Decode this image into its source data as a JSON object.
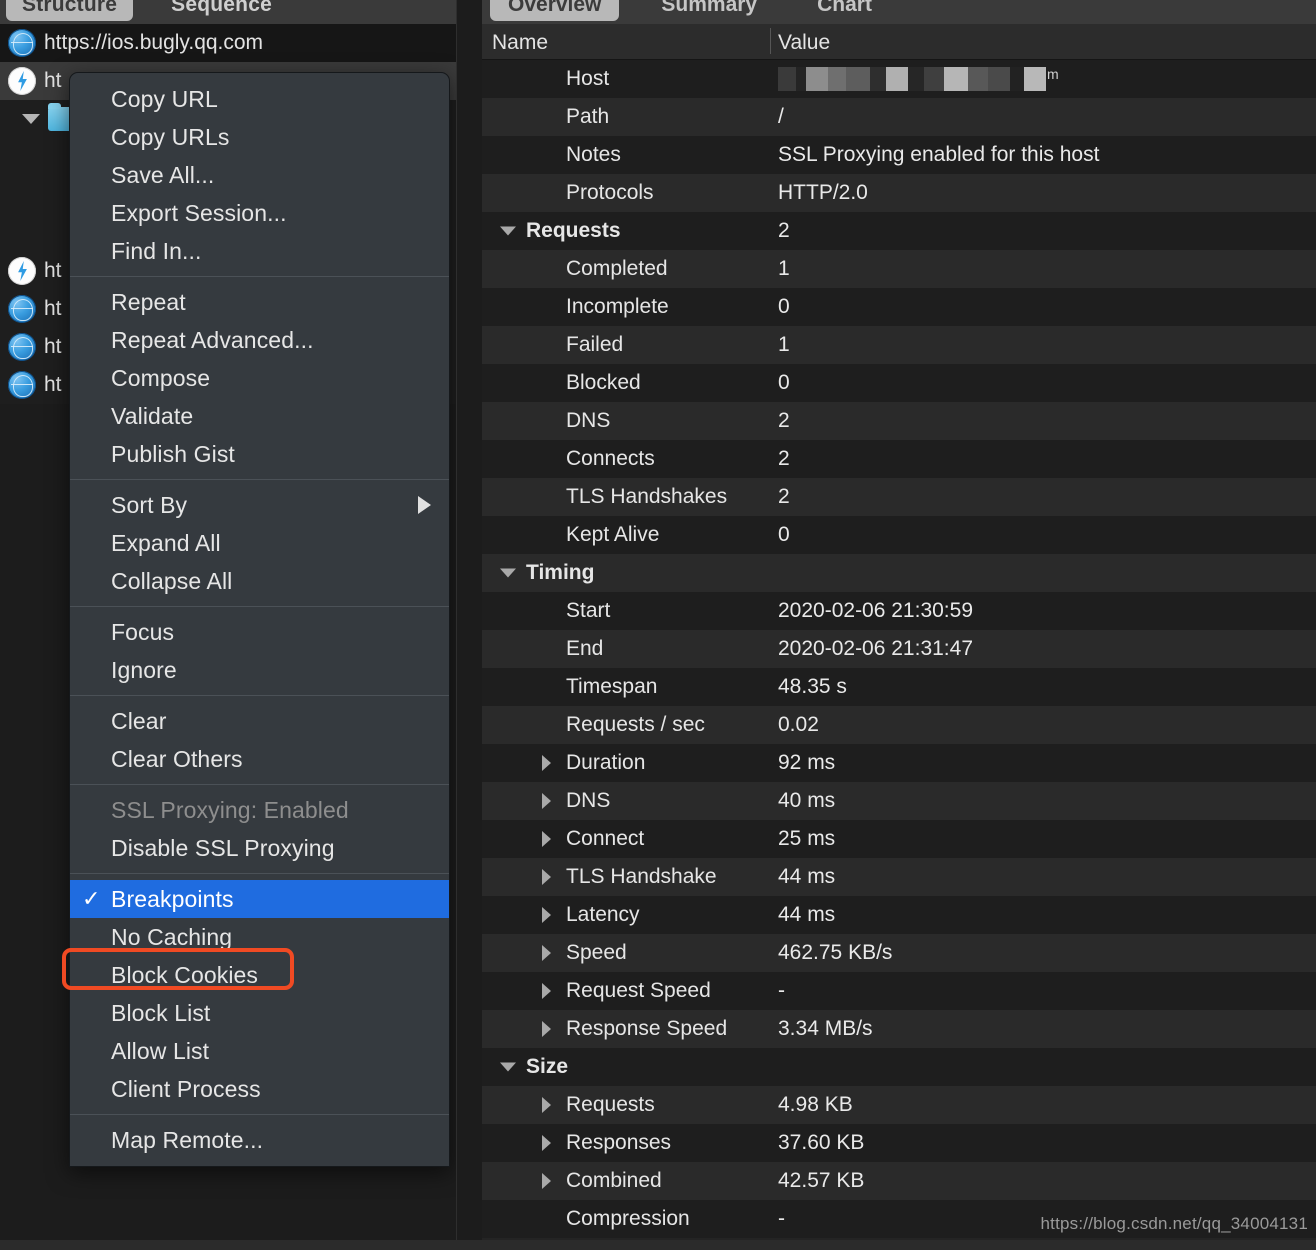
{
  "left_panel": {
    "tabs": [
      {
        "label": "Structure",
        "selected": true
      },
      {
        "label": "Sequence",
        "selected": false
      }
    ],
    "rows": [
      {
        "icon": "globe-icon",
        "label": "https://ios.bugly.qq.com",
        "style": "plain"
      },
      {
        "icon": "bolt-icon",
        "label": "ht",
        "style": "selected"
      },
      {
        "icon": "folder-icon",
        "label": "",
        "style": "disclosure"
      },
      {
        "icon": "none",
        "label": "",
        "style": "blank"
      },
      {
        "icon": "none",
        "label": "",
        "style": "blank"
      },
      {
        "icon": "none",
        "label": "",
        "style": "blank"
      },
      {
        "icon": "bolt-icon",
        "label": "ht",
        "style": "plain"
      },
      {
        "icon": "globe-icon",
        "label": "ht",
        "style": "plain"
      },
      {
        "icon": "globe-icon",
        "label": "ht",
        "style": "plain"
      },
      {
        "icon": "globe-icon",
        "label": "ht",
        "style": "plain"
      }
    ]
  },
  "context_menu": {
    "groups": [
      {
        "items": [
          {
            "label": "Copy URL"
          },
          {
            "label": "Copy URLs"
          },
          {
            "label": "Save All..."
          },
          {
            "label": "Export Session..."
          },
          {
            "label": "Find In..."
          }
        ]
      },
      {
        "items": [
          {
            "label": "Repeat"
          },
          {
            "label": "Repeat Advanced..."
          },
          {
            "label": "Compose"
          },
          {
            "label": "Validate"
          },
          {
            "label": "Publish Gist"
          }
        ]
      },
      {
        "items": [
          {
            "label": "Sort By",
            "submenu": true
          },
          {
            "label": "Expand All"
          },
          {
            "label": "Collapse All"
          }
        ]
      },
      {
        "items": [
          {
            "label": "Focus"
          },
          {
            "label": "Ignore"
          }
        ]
      },
      {
        "items": [
          {
            "label": "Clear"
          },
          {
            "label": "Clear Others"
          }
        ]
      },
      {
        "items": [
          {
            "label": "SSL Proxying: Enabled",
            "disabled": true
          },
          {
            "label": "Disable SSL Proxying"
          }
        ]
      },
      {
        "items": [
          {
            "label": "Breakpoints",
            "checked": true,
            "highlighted": true
          },
          {
            "label": "No Caching"
          },
          {
            "label": "Block Cookies"
          },
          {
            "label": "Block List"
          },
          {
            "label": "Allow List"
          },
          {
            "label": "Client Process"
          }
        ]
      },
      {
        "items": [
          {
            "label": "Map Remote..."
          }
        ]
      }
    ],
    "checkmark_glyph": "✓",
    "highlight_color": "#1f6ce0",
    "annotation_color": "#f04a23"
  },
  "right_panel": {
    "tabs": [
      {
        "label": "Overview",
        "selected": true
      },
      {
        "label": "Summary",
        "selected": false
      },
      {
        "label": "Chart",
        "selected": false
      }
    ],
    "columns": {
      "name": "Name",
      "value": "Value"
    },
    "rows": [
      {
        "name": "Host",
        "value": "",
        "level": 1,
        "redacted": true,
        "redacted_suffix": "m"
      },
      {
        "name": "Path",
        "value": "/",
        "level": 1
      },
      {
        "name": "Notes",
        "value": "SSL Proxying enabled for this host",
        "level": 1
      },
      {
        "name": "Protocols",
        "value": "HTTP/2.0",
        "level": 1
      },
      {
        "name": "Requests",
        "value": "2",
        "level": 0,
        "expanded": true
      },
      {
        "name": "Completed",
        "value": "1",
        "level": 1
      },
      {
        "name": "Incomplete",
        "value": "0",
        "level": 1
      },
      {
        "name": "Failed",
        "value": "1",
        "level": 1
      },
      {
        "name": "Blocked",
        "value": "0",
        "level": 1
      },
      {
        "name": "DNS",
        "value": "2",
        "level": 1
      },
      {
        "name": "Connects",
        "value": "2",
        "level": 1
      },
      {
        "name": "TLS Handshakes",
        "value": "2",
        "level": 1
      },
      {
        "name": "Kept Alive",
        "value": "0",
        "level": 1
      },
      {
        "name": "Timing",
        "value": "",
        "level": 0,
        "expanded": true
      },
      {
        "name": "Start",
        "value": "2020-02-06 21:30:59",
        "level": 1
      },
      {
        "name": "End",
        "value": "2020-02-06 21:31:47",
        "level": 1
      },
      {
        "name": "Timespan",
        "value": "48.35 s",
        "level": 1
      },
      {
        "name": "Requests / sec",
        "value": "0.02",
        "level": 1
      },
      {
        "name": "Duration",
        "value": "92 ms",
        "level": 1,
        "collapsed": true
      },
      {
        "name": "DNS",
        "value": "40 ms",
        "level": 1,
        "collapsed": true
      },
      {
        "name": "Connect",
        "value": "25 ms",
        "level": 1,
        "collapsed": true
      },
      {
        "name": "TLS Handshake",
        "value": "44 ms",
        "level": 1,
        "collapsed": true
      },
      {
        "name": "Latency",
        "value": "44 ms",
        "level": 1,
        "collapsed": true
      },
      {
        "name": "Speed",
        "value": "462.75 KB/s",
        "level": 1,
        "collapsed": true
      },
      {
        "name": "Request Speed",
        "value": "-",
        "level": 1,
        "collapsed": true
      },
      {
        "name": "Response Speed",
        "value": "3.34 MB/s",
        "level": 1,
        "collapsed": true
      },
      {
        "name": "Size",
        "value": "",
        "level": 0,
        "expanded": true
      },
      {
        "name": "Requests",
        "value": "4.98 KB",
        "level": 1,
        "collapsed": true
      },
      {
        "name": "Responses",
        "value": "37.60 KB",
        "level": 1,
        "collapsed": true
      },
      {
        "name": "Combined",
        "value": "42.57 KB",
        "level": 1,
        "collapsed": true
      },
      {
        "name": "Compression",
        "value": "-",
        "level": 1
      }
    ]
  },
  "watermark": "https://blog.csdn.net/qq_34004131"
}
